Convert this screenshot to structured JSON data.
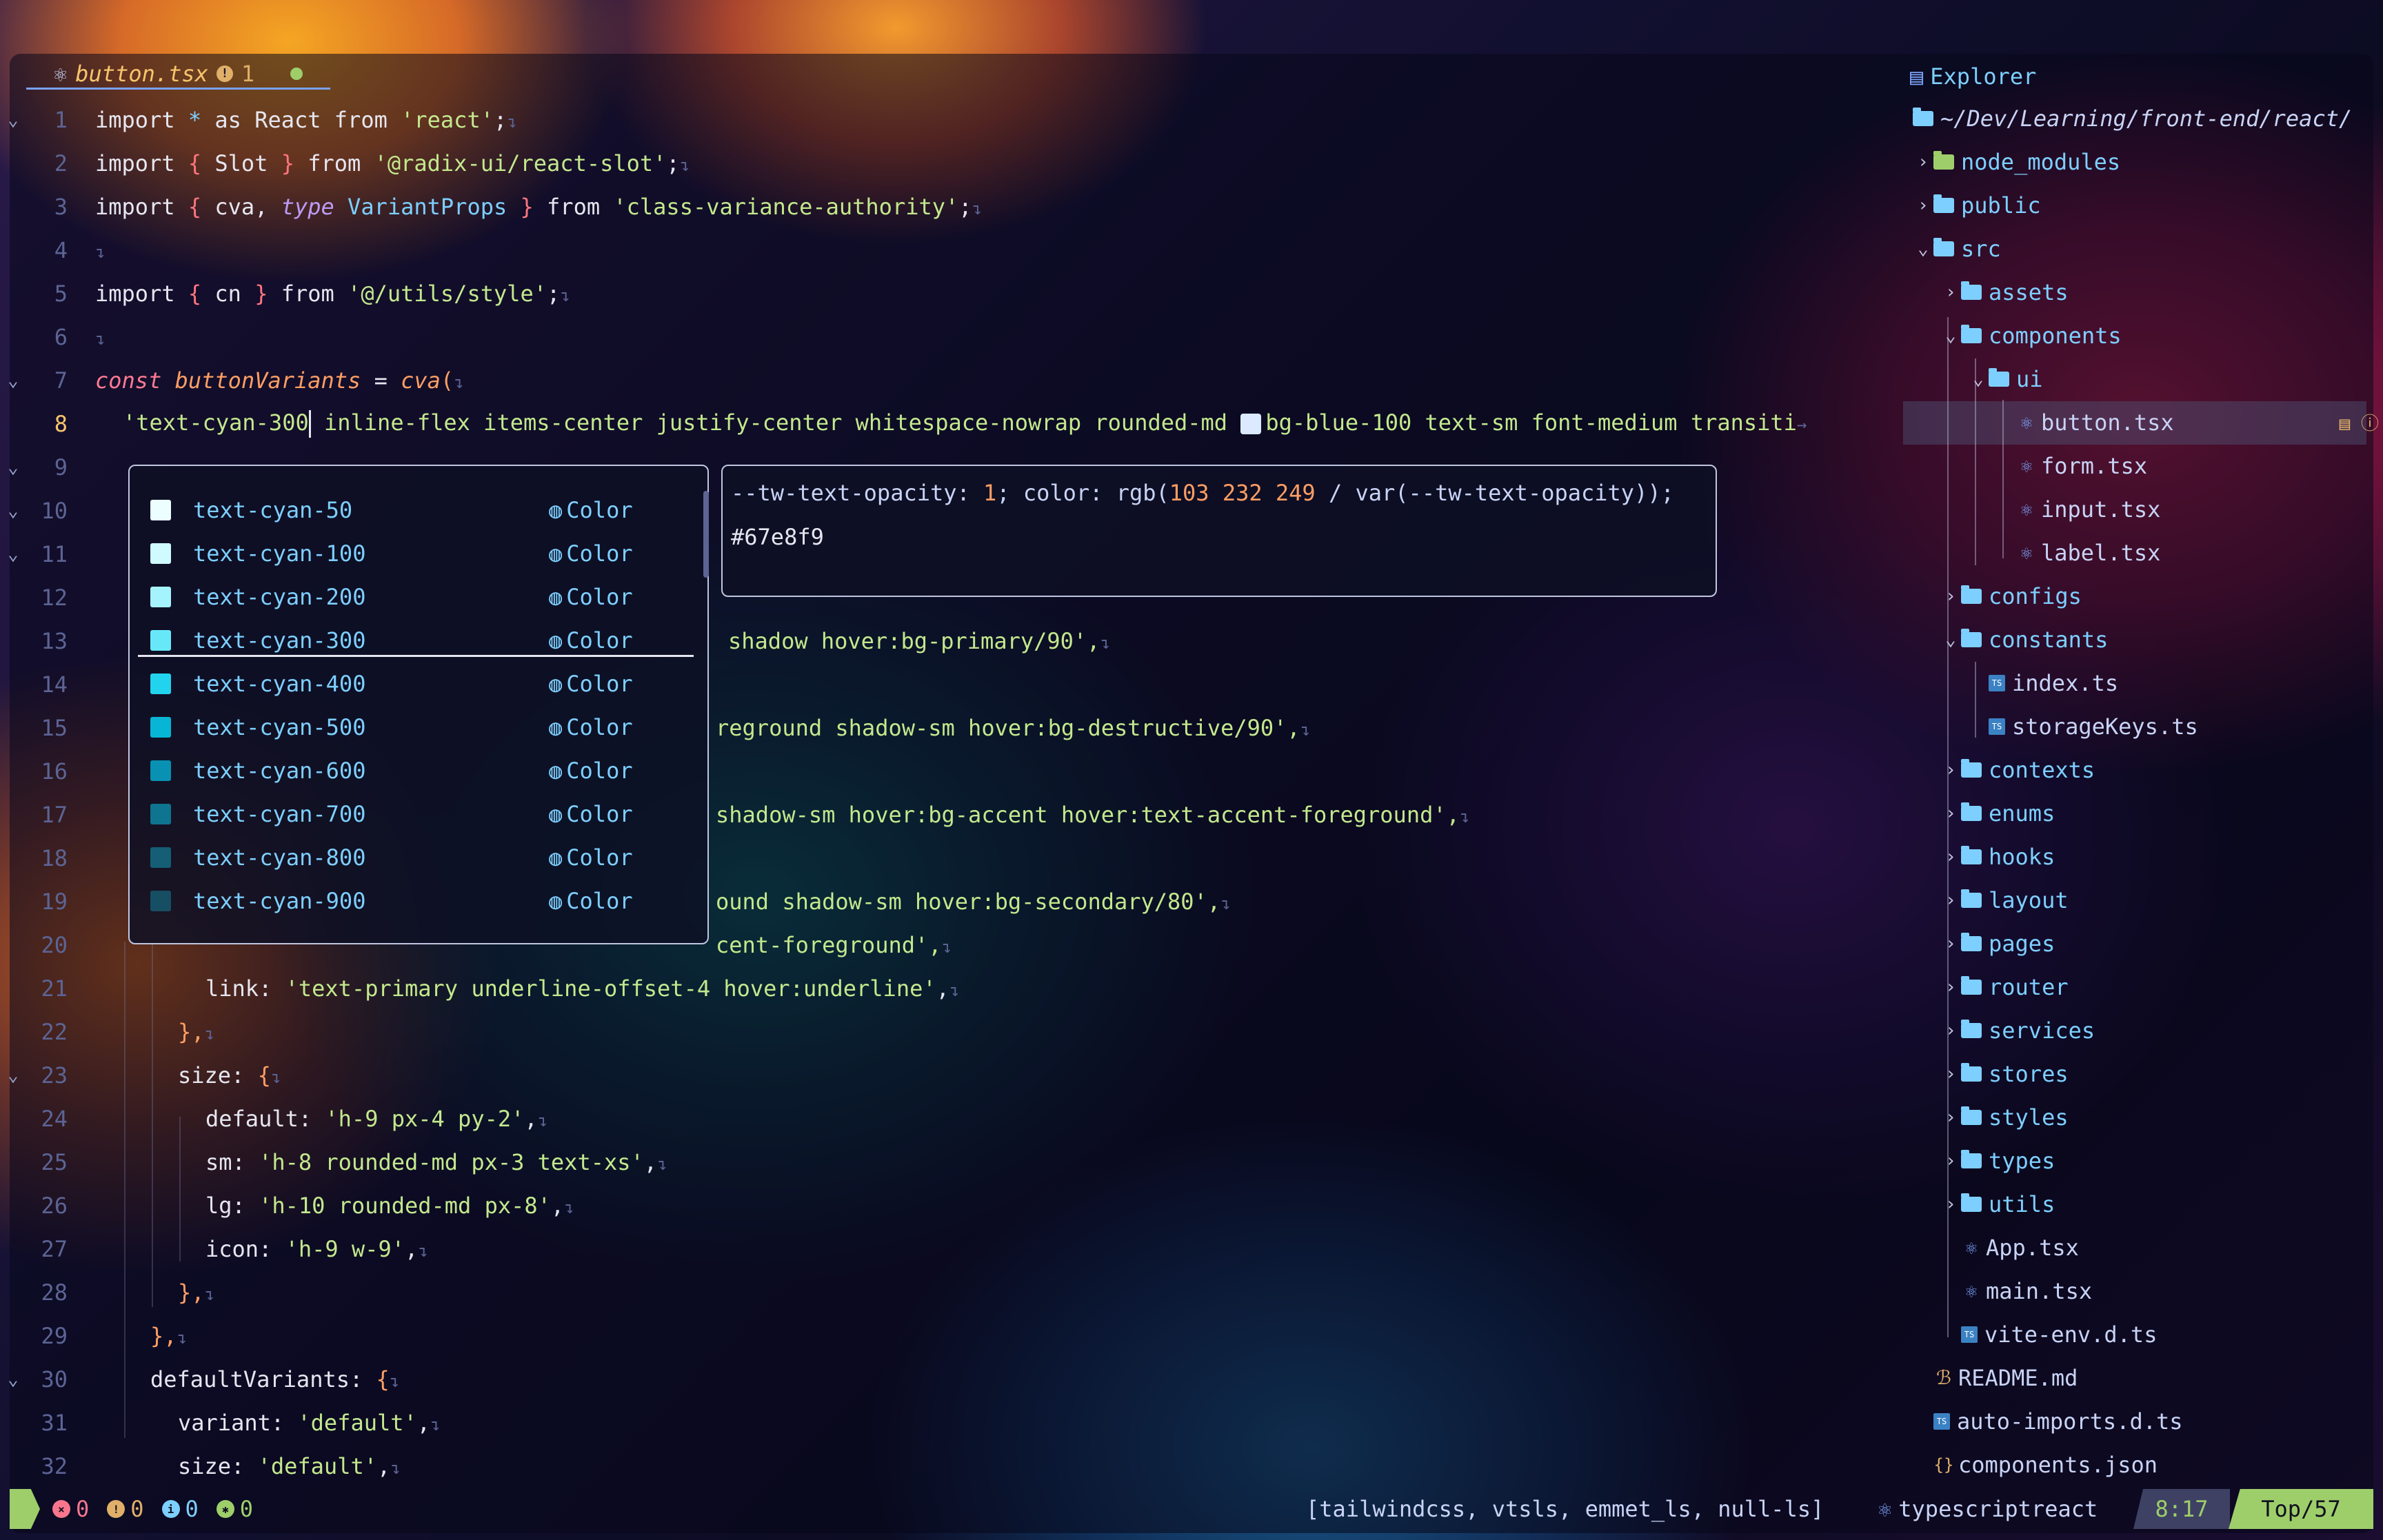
{
  "tab": {
    "filename": "button.tsx",
    "warning_count": "1"
  },
  "editor": {
    "lines": [
      {
        "n": "1",
        "top": 0
      },
      {
        "n": "2"
      },
      {
        "n": "3"
      },
      {
        "n": "4"
      },
      {
        "n": "5"
      },
      {
        "n": "6"
      },
      {
        "n": "7"
      },
      {
        "n": "8"
      }
    ],
    "line_numbers": [
      "1",
      "2",
      "3",
      "4",
      "5",
      "6",
      "7",
      "8",
      "9",
      "10",
      "11",
      "12",
      "13",
      "14",
      "15",
      "16",
      "17",
      "18",
      "19",
      "20",
      "21",
      "22",
      "23",
      "24",
      "25",
      "26",
      "27",
      "28",
      "29",
      "30",
      "31",
      "32"
    ],
    "current_line": "8",
    "l1": {
      "a": "import",
      "b": " * ",
      "c": "as",
      "d": " React ",
      "e": "from",
      "f": " 'react'",
      "g": ";"
    },
    "l2": {
      "a": "import",
      "b": " { ",
      "c": "Slot",
      "d": " } ",
      "e": "from",
      "f": " '@radix-ui/react-slot'",
      "g": ";"
    },
    "l3": {
      "a": "import",
      "b": " { ",
      "c": "cva, ",
      "t": "type",
      "c2": " VariantProps",
      "d": " } ",
      "e": "from",
      "f": " 'class-variance-authority'",
      "g": ";"
    },
    "l5": {
      "a": "import",
      "b": " { ",
      "c": "cn",
      "d": " } ",
      "e": "from",
      "f": " '@/utils/style'",
      "g": ";"
    },
    "l7": {
      "a": "const",
      "b": " buttonVariants",
      "c": " = ",
      "d": "cva",
      "e": "("
    },
    "l8": {
      "a": "'text-cyan-300",
      "b": " inline-flex items-center justify-center whitespace-nowrap rounded-md ",
      "c": "bg-blue-100 text-sm font-medium transiti",
      "d": "→"
    },
    "l13": "shadow hover:bg-primary/90',",
    "l15": "reground shadow-sm hover:bg-destructive/90',",
    "l17": "shadow-sm hover:bg-accent hover:text-accent-foreground',",
    "l19": "ound shadow-sm hover:bg-secondary/80',",
    "l20": "cent-foreground',",
    "l21": {
      "k": "link:",
      "v": " 'text-primary underline-offset-4 hover:underline'",
      "p": ","
    },
    "l22": "},",
    "l23": {
      "k": "size:",
      "p": " {"
    },
    "l24": {
      "k": "default:",
      "v": " 'h-9 px-4 py-2'",
      "p": ","
    },
    "l25": {
      "k": "sm:",
      "v": " 'h-8 rounded-md px-3 text-xs'",
      "p": ","
    },
    "l26": {
      "k": "lg:",
      "v": " 'h-10 rounded-md px-8'",
      "p": ","
    },
    "l27": {
      "k": "icon:",
      "v": " 'h-9 w-9'",
      "p": ","
    },
    "l28": "},",
    "l29": "},",
    "l30": {
      "k": "defaultVariants:",
      "p": " {"
    },
    "l31": {
      "k": "variant:",
      "v": " 'default'",
      "p": ","
    },
    "l32": {
      "k": "size:",
      "v": " 'default'",
      "p": ","
    }
  },
  "completion": {
    "items": [
      {
        "label": "text-cyan-50",
        "kind": "Color",
        "color": "#ecfeff"
      },
      {
        "label": "text-cyan-100",
        "kind": "Color",
        "color": "#cffafe"
      },
      {
        "label": "text-cyan-200",
        "kind": "Color",
        "color": "#a5f3fc"
      },
      {
        "label": "text-cyan-300",
        "kind": "Color",
        "color": "#67e8f9"
      },
      {
        "label": "text-cyan-400",
        "kind": "Color",
        "color": "#22d3ee"
      },
      {
        "label": "text-cyan-500",
        "kind": "Color",
        "color": "#06b6d4"
      },
      {
        "label": "text-cyan-600",
        "kind": "Color",
        "color": "#0891b2"
      },
      {
        "label": "text-cyan-700",
        "kind": "Color",
        "color": "#0e7490"
      },
      {
        "label": "text-cyan-800",
        "kind": "Color",
        "color": "#155e75"
      },
      {
        "label": "text-cyan-900",
        "kind": "Color",
        "color": "#164e63"
      }
    ],
    "doc_line1_a": "--tw-text-opacity: ",
    "doc_line1_b": "1",
    "doc_line1_c": "; color: rgb(",
    "doc_line1_d": "103 232 249",
    "doc_line1_e": " / var(--tw-text-opacity));",
    "doc_line2": "#67e8f9"
  },
  "explorer": {
    "title": "Explorer",
    "root": "~/Dev/Learning/front-end/react/",
    "entries": [
      {
        "name": "node_modules"
      },
      {
        "name": "public"
      },
      {
        "name": "src"
      },
      {
        "name": "assets"
      },
      {
        "name": "components"
      },
      {
        "name": "ui"
      },
      {
        "name": "button.tsx"
      },
      {
        "name": "form.tsx"
      },
      {
        "name": "input.tsx"
      },
      {
        "name": "label.tsx"
      },
      {
        "name": "configs"
      },
      {
        "name": "constants"
      },
      {
        "name": "index.ts"
      },
      {
        "name": "storageKeys.ts"
      },
      {
        "name": "contexts"
      },
      {
        "name": "enums"
      },
      {
        "name": "hooks"
      },
      {
        "name": "layout"
      },
      {
        "name": "pages"
      },
      {
        "name": "router"
      },
      {
        "name": "services"
      },
      {
        "name": "stores"
      },
      {
        "name": "styles"
      },
      {
        "name": "types"
      },
      {
        "name": "utils"
      },
      {
        "name": "App.tsx"
      },
      {
        "name": "main.tsx"
      },
      {
        "name": "vite-env.d.ts"
      },
      {
        "name": "README.md"
      },
      {
        "name": "auto-imports.d.ts"
      },
      {
        "name": "components.json"
      }
    ]
  },
  "status": {
    "errors": "0",
    "warnings": "0",
    "info": "0",
    "hints": "0",
    "lsp": "[tailwindcss, vtsls, emmet_ls, null-ls]",
    "filetype": "typescriptreact",
    "position": "8:17",
    "scroll": "Top/57"
  }
}
